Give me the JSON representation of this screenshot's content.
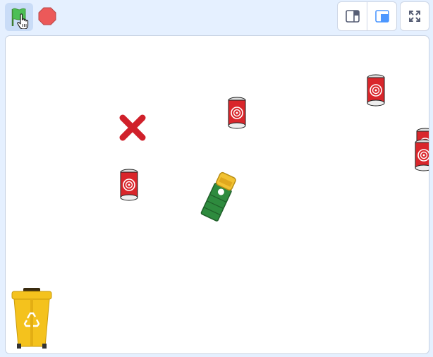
{
  "toolbar": {
    "green_flag_icon": "green-flag-icon",
    "stop_icon": "stop-sign-icon",
    "layout_small_stage_icon": "small-stage-layout-icon",
    "layout_normal_stage_icon": "normal-stage-layout-icon",
    "fullscreen_icon": "fullscreen-icon"
  },
  "stage": {
    "sprites": [
      {
        "name": "x-mark",
        "icon": "red-x-icon"
      },
      {
        "name": "soda-can",
        "icon": "soda-can-icon"
      },
      {
        "name": "soda-can",
        "icon": "soda-can-icon"
      },
      {
        "name": "soda-can",
        "icon": "soda-can-icon"
      },
      {
        "name": "soda-can",
        "icon": "soda-can-icon"
      },
      {
        "name": "soda-can",
        "icon": "soda-can-icon"
      },
      {
        "name": "truck",
        "icon": "garbage-truck-icon"
      },
      {
        "name": "recycle-bin",
        "icon": "recycle-bin-icon"
      }
    ]
  },
  "colors": {
    "toolbar_bg": "#e5f0ff",
    "flag_active_bg": "#c9dcf7",
    "stop_red": "#ec5959",
    "layout_accent": "#4c97ff",
    "can_red": "#d9262b",
    "x_red": "#d0202a",
    "truck_green": "#2e8b3e",
    "truck_yellow": "#f2c232",
    "bin_yellow": "#f4c21d"
  }
}
